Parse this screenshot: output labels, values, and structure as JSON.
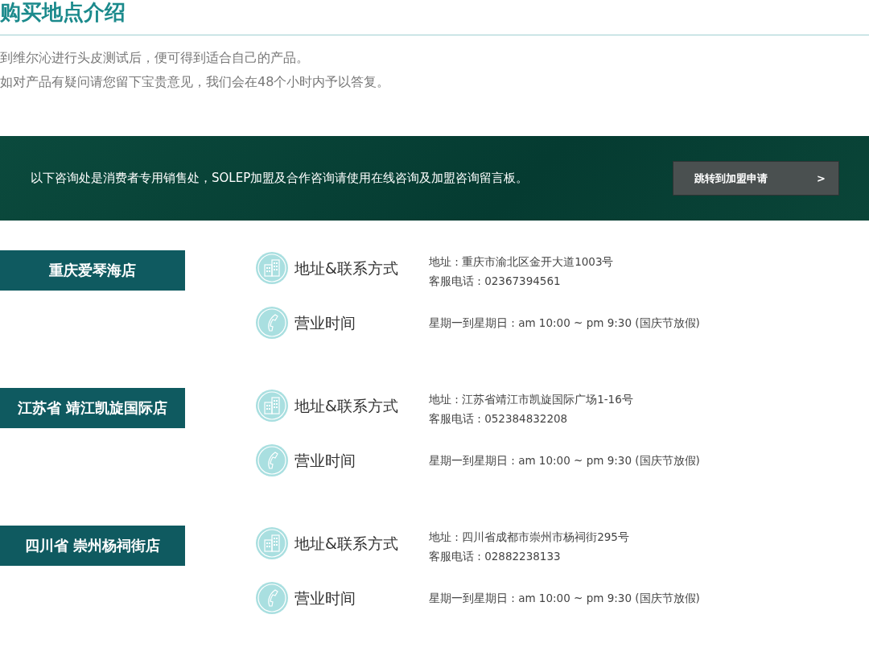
{
  "title": "购买地点介绍",
  "intro": [
    "到维尔沁进行头皮测试后，便可得到适合自己的产品。",
    "如对产品有疑问请您留下宝贵意见，我们会在48个小时内予以答复。"
  ],
  "banner": {
    "text": "以下咨询处是消费者专用销售处，SOLEP加盟及合作咨询请使用在线咨询及加盟咨询留言板。",
    "button": {
      "label": "跳转到加盟申请",
      "arrow": ">"
    }
  },
  "stores": [
    {
      "name": "重庆爱琴海店",
      "contact_heading": "地址&联系方式",
      "address": "地址 : 重庆市渝北区金开大道1003号",
      "phone": "客服电话 : 02367394561",
      "hours_heading": "营业时间",
      "hours": "星期一到星期日 : am 10:00 ~ pm 9:30 (国庆节放假)"
    },
    {
      "name": "江苏省 靖江凯旋国际店",
      "contact_heading": "地址&联系方式",
      "address": "地址 : 江苏省靖江市凯旋国际广场1-16号",
      "phone": "客服电话 : 052384832208",
      "hours_heading": "营业时间",
      "hours": "星期一到星期日 : am 10:00 ~ pm 9:30 (国庆节放假)"
    },
    {
      "name": "四川省 崇州杨祠街店",
      "contact_heading": "地址&联系方式",
      "address": "地址 : 四川省成都市崇州市杨祠街295号",
      "phone": "客服电话 : 02882238133",
      "hours_heading": "营业时间",
      "hours": "星期一到星期日 : am 10:00 ~ pm 9:30 (国庆节放假)"
    }
  ]
}
